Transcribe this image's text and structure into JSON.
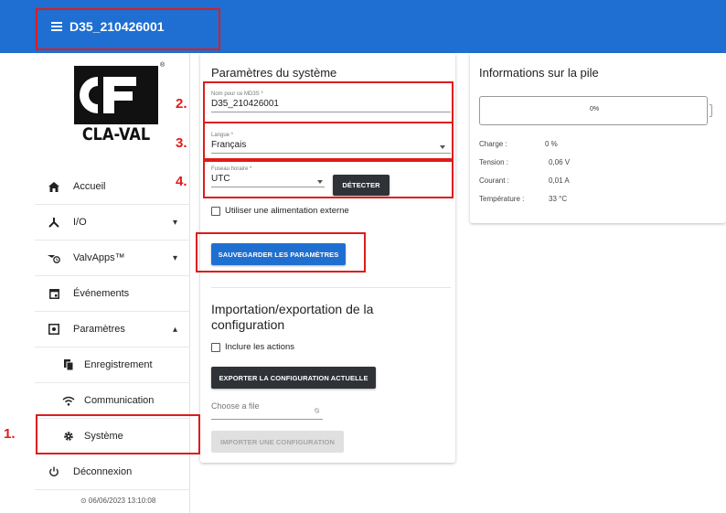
{
  "topbar": {
    "title": "D35_210426001"
  },
  "logo": {
    "text": "CLA-VAL",
    "registered": "®"
  },
  "sidebar": {
    "items": [
      {
        "label": "Accueil",
        "icon": "home-icon"
      },
      {
        "label": "I/O",
        "icon": "io-icon",
        "chevron": "▾"
      },
      {
        "label": "ValvApps™",
        "icon": "valvapps-icon",
        "chevron": "▾"
      },
      {
        "label": "Événements",
        "icon": "calendar-icon"
      },
      {
        "label": "Paramètres",
        "icon": "settings-panel-icon",
        "chevron": "▴"
      },
      {
        "label": "Enregistrement",
        "icon": "document-copy-icon"
      },
      {
        "label": "Communication",
        "icon": "wifi-icon"
      },
      {
        "label": "Système",
        "icon": "gear-icon"
      },
      {
        "label": "Déconnexion",
        "icon": "power-icon"
      }
    ],
    "timestamp": "⊙ 06/06/2023 13:10:08"
  },
  "system": {
    "title": "Paramètres du système",
    "name_label": "Nom pour ce MD3S *",
    "name_value": "D35_210426001",
    "language_label": "Langue *",
    "language_value": "Français",
    "timezone_label": "Fuseau horaire *",
    "timezone_value": "UTC",
    "detect_button": "DÉTECTER",
    "external_power": "Utiliser une alimentation externe",
    "save_button": "SAUVEGARDER LES PARAMÈTRES"
  },
  "import_export": {
    "title": "Importation/exportation de la configuration",
    "include_actions": "Inclure les actions",
    "export_button": "EXPORTER LA CONFIGURATION ACTUELLE",
    "file_placeholder": "Choose a file",
    "import_button": "IMPORTER UNE CONFIGURATION"
  },
  "battery": {
    "title": "Informations sur la pile",
    "percent": "0%",
    "fill_fraction": 0,
    "stats": [
      {
        "label": "Charge :",
        "value": "0 %"
      },
      {
        "label": "Tension :",
        "value": "0,06 V"
      },
      {
        "label": "Courant :",
        "value": "0,01 A"
      },
      {
        "label": "Température :",
        "value": "33 °C"
      }
    ]
  },
  "annotations": [
    "1.",
    "2.",
    "3.",
    "4."
  ],
  "colors": {
    "primary": "#1e6fd1",
    "annotation": "#e01b1b",
    "dark_button": "#2f3338"
  }
}
